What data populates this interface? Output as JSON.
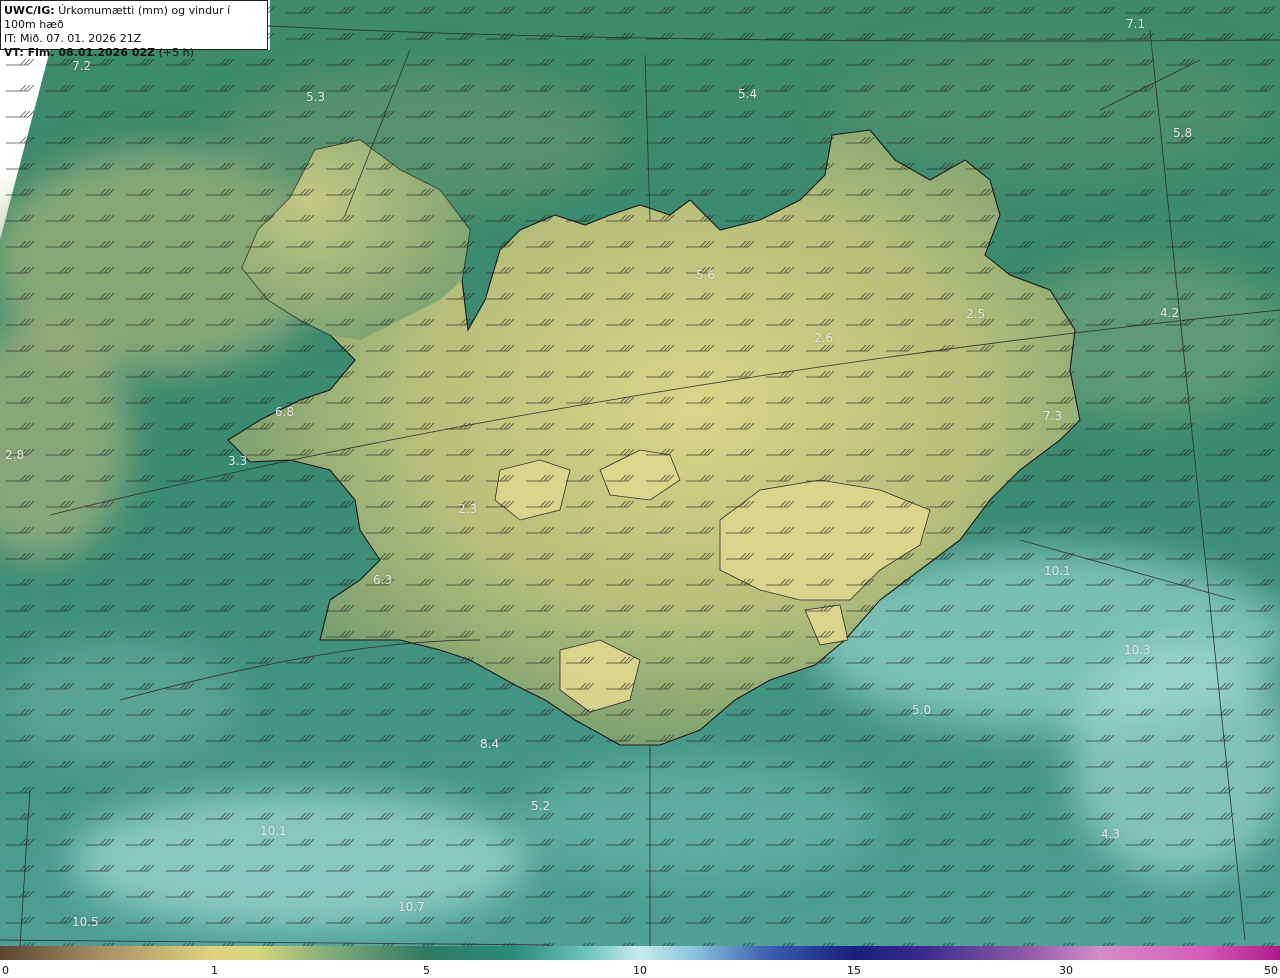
{
  "header": {
    "line1_bold": "UWC/IG:",
    "line1_rest": "Úrkomumætti (mm) og vindur í 100m hæð",
    "line2": "IT: Mið. 07. 01. 2026 21Z",
    "line3_bold": "VT: Fim. 08.01.2026 02Z",
    "line3_rest": "(+5 h)"
  },
  "field_values": [
    {
      "text": "7.2",
      "pos": [
        72,
        67
      ]
    },
    {
      "text": "5.3",
      "pos": [
        306,
        98
      ]
    },
    {
      "text": "5.4",
      "pos": [
        738,
        95
      ]
    },
    {
      "text": "7.1",
      "pos": [
        1126,
        25
      ]
    },
    {
      "text": "5.8",
      "pos": [
        1173,
        134
      ]
    },
    {
      "text": "5.6",
      "pos": [
        696,
        276
      ]
    },
    {
      "text": "2.5",
      "pos": [
        966,
        315
      ]
    },
    {
      "text": "2.6",
      "pos": [
        814,
        339
      ]
    },
    {
      "text": "4.2",
      "pos": [
        1160,
        314
      ]
    },
    {
      "text": "6.8",
      "pos": [
        275,
        413
      ]
    },
    {
      "text": "7.3",
      "pos": [
        1043,
        417
      ]
    },
    {
      "text": "2.8",
      "pos": [
        5,
        456
      ]
    },
    {
      "text": "3.3",
      "pos": [
        228,
        462
      ]
    },
    {
      "text": "2.3",
      "pos": [
        458,
        510
      ]
    },
    {
      "text": "10.1",
      "pos": [
        1044,
        572
      ]
    },
    {
      "text": "6.3",
      "pos": [
        373,
        581
      ]
    },
    {
      "text": "10.3",
      "pos": [
        1124,
        651
      ]
    },
    {
      "text": "5.0",
      "pos": [
        912,
        711
      ]
    },
    {
      "text": "8.4",
      "pos": [
        480,
        745
      ]
    },
    {
      "text": "5.2",
      "pos": [
        531,
        807
      ]
    },
    {
      "text": "10.1",
      "pos": [
        260,
        832
      ]
    },
    {
      "text": "4.3",
      "pos": [
        1101,
        835
      ]
    },
    {
      "text": "10.7",
      "pos": [
        398,
        908
      ]
    },
    {
      "text": "10.5",
      "pos": [
        72,
        923
      ]
    }
  ],
  "legend": {
    "ticks": [
      "0",
      "1",
      "5",
      "10",
      "15",
      "30",
      "50"
    ]
  },
  "colors": {
    "sea_deep": "#2d7a66",
    "sea_light": "#7fcbc6",
    "land_yellow": "#d6d286",
    "land_green": "#6d9a70",
    "coast": "#1a1a1a"
  }
}
